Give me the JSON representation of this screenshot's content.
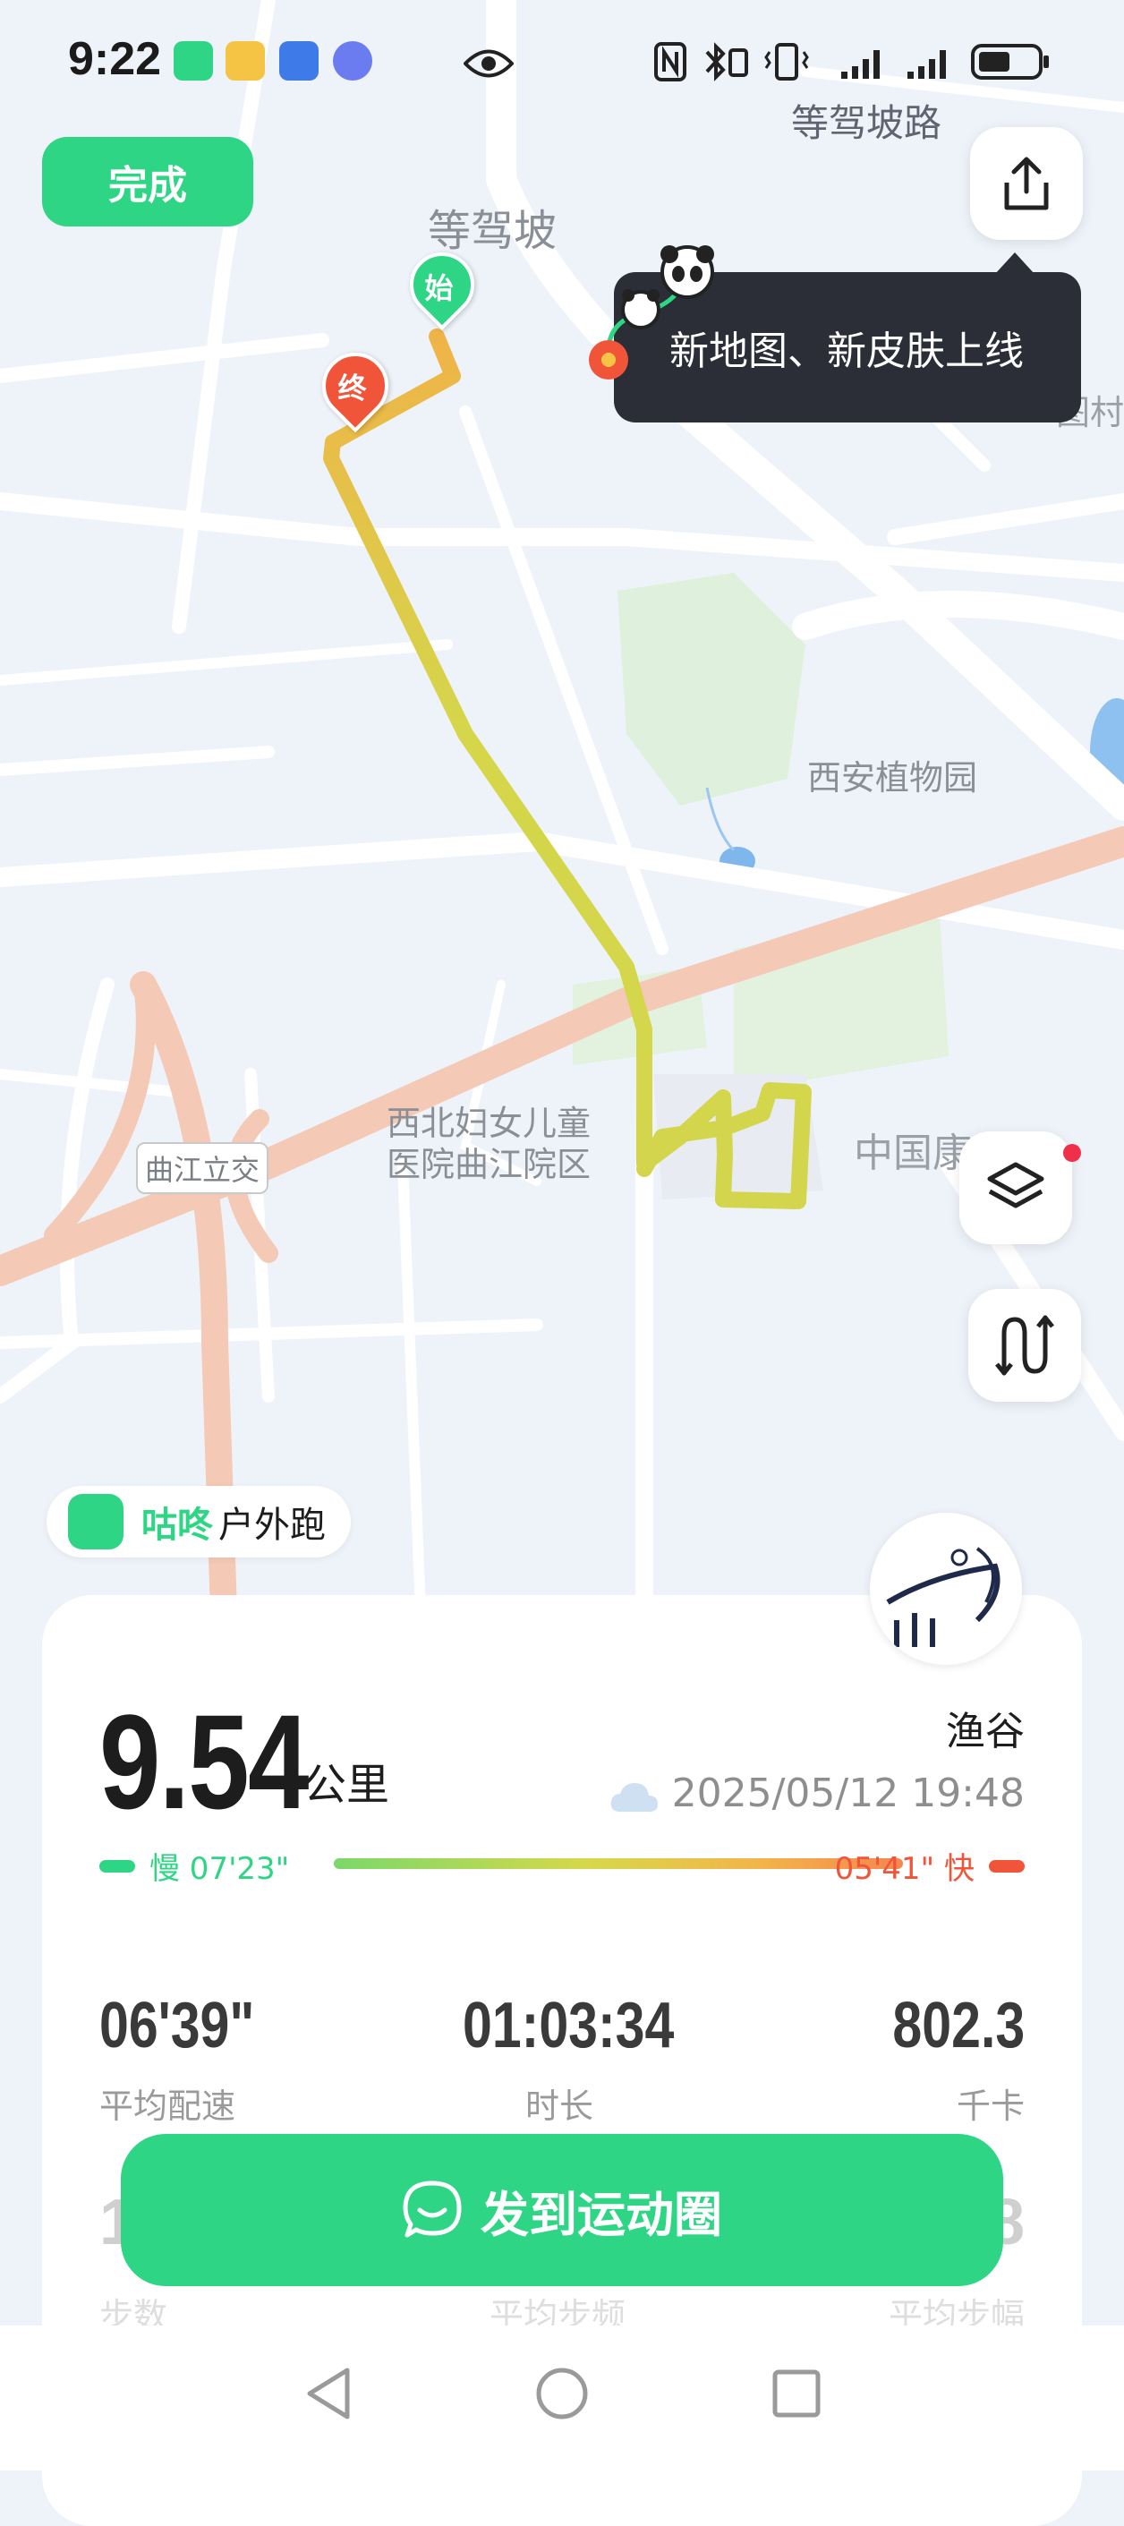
{
  "status_bar": {
    "time": "9:22"
  },
  "header": {
    "done_label": "完成"
  },
  "map": {
    "labels": {
      "road_top": "等驾坡路",
      "area_top": "等驾坡",
      "garden": "西安植物园",
      "hospital_line1": "西北妇女儿童",
      "hospital_line2": "医院曲江院区",
      "interchange": "曲江立交",
      "china_partial": "中国康",
      "right_edge_partial": "图村"
    },
    "start_marker": "始",
    "end_marker": "终"
  },
  "tooltip": {
    "text": "新地图、新皮肤上线"
  },
  "brand": {
    "name": "咕咚",
    "activity": "户外跑"
  },
  "summary": {
    "distance": "9.54",
    "distance_unit": "公里",
    "user": "渔谷",
    "datetime": "2025/05/12 19:48",
    "pace_slow": "慢 07'23\"",
    "pace_fast": "05'41\" 快"
  },
  "stats": [
    {
      "value": "06'39\"",
      "label": "平均配速"
    },
    {
      "value": "01:03:34",
      "label": "时长"
    },
    {
      "value": "802.3",
      "label": "千卡"
    }
  ],
  "stats_row2": [
    {
      "value": "1",
      "label": "步数"
    },
    {
      "value": "",
      "label": "平均步频"
    },
    {
      "value": "8",
      "label": "平均步幅"
    }
  ],
  "share": {
    "label": "发到运动圈"
  },
  "colors": {
    "accent": "#2ed584",
    "fast": "#f0553a",
    "route_yellow": "#d5d64a",
    "route_orange": "#efb448"
  }
}
